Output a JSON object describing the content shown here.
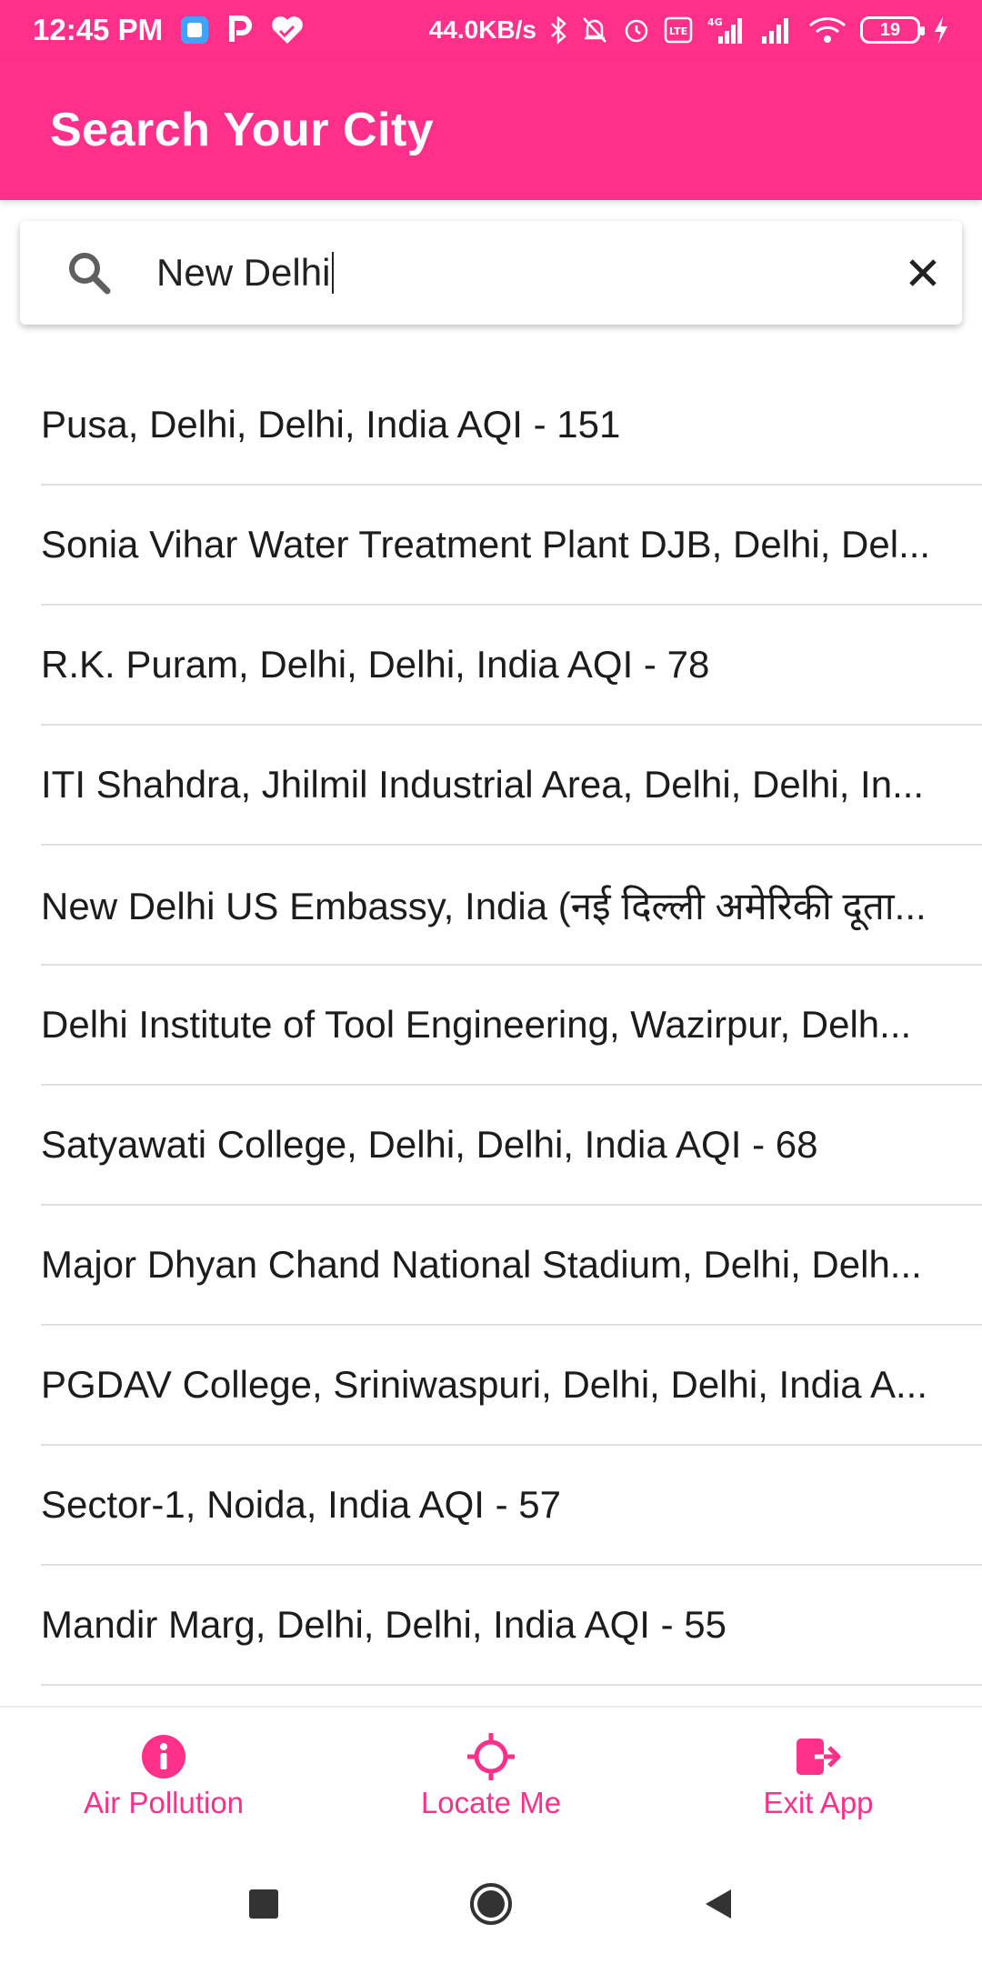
{
  "status_bar": {
    "time": "12:45 PM",
    "network_speed": "44.0KB/s",
    "battery": "19"
  },
  "app_bar": {
    "title": "Search Your City"
  },
  "search": {
    "value": "New Delhi"
  },
  "results": [
    "Pusa, Delhi, Delhi, India AQI - 151",
    "Sonia Vihar Water Treatment Plant DJB, Delhi, Del...",
    "R.K. Puram, Delhi, Delhi, India AQI - 78",
    "ITI Shahdra, Jhilmil Industrial Area, Delhi, Delhi, In...",
    "New Delhi US Embassy, India (नई दिल्ली अमेरिकी दूता...",
    "Delhi Institute of Tool Engineering, Wazirpur, Delh...",
    "Satyawati College, Delhi, Delhi, India AQI - 68",
    "Major Dhyan Chand National Stadium, Delhi, Delh...",
    "PGDAV College, Sriniwaspuri, Delhi, Delhi, India A...",
    "Sector-1, Noida, India AQI - 57",
    "Mandir Marg, Delhi, Delhi, India AQI - 55"
  ],
  "bottom_nav": {
    "items": [
      {
        "label": "Air Pollution",
        "icon": "info-icon"
      },
      {
        "label": "Locate Me",
        "icon": "locate-icon"
      },
      {
        "label": "Exit App",
        "icon": "exit-icon"
      }
    ]
  },
  "colors": {
    "accent": "#ff2f8a",
    "divider": "#e0e0e0"
  }
}
